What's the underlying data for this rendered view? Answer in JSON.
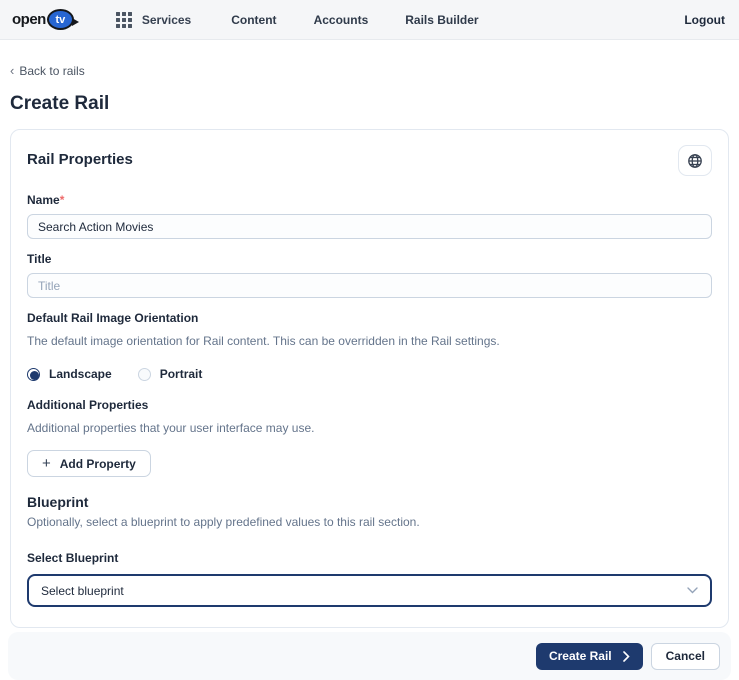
{
  "navbar": {
    "logo": {
      "text_open": "open",
      "text_tv": "tv"
    },
    "services_label": "Services",
    "items": [
      {
        "label": "Content"
      },
      {
        "label": "Accounts"
      },
      {
        "label": "Rails Builder"
      }
    ],
    "logout_label": "Logout"
  },
  "page": {
    "back_link_label": "Back to rails",
    "title": "Create Rail"
  },
  "form": {
    "section_title": "Rail Properties",
    "name_field": {
      "label": "Name",
      "required_mark": "*",
      "value": "Search Action Movies"
    },
    "title_field": {
      "label": "Title",
      "placeholder": "Title"
    },
    "orientation": {
      "label": "Default Rail Image Orientation",
      "description": "The default image orientation for Rail content. This can be overridden in the Rail settings.",
      "options": [
        {
          "label": "Landscape",
          "selected": true
        },
        {
          "label": "Portrait",
          "selected": false
        }
      ]
    },
    "additional_properties": {
      "label": "Additional Properties",
      "description": "Additional properties that your user interface may use.",
      "add_button_label": "Add Property"
    },
    "blueprint": {
      "title": "Blueprint",
      "description": "Optionally, select a blueprint to apply predefined values to this rail section.",
      "select_label": "Select Blueprint",
      "select_value": "Select blueprint"
    }
  },
  "footer": {
    "create_button_label": "Create Rail",
    "cancel_button_label": "Cancel"
  },
  "icons": {
    "back_chevron": "‹",
    "plus": "+",
    "create_chevron": "›"
  },
  "colors": {
    "accent_navy": "#1e3a6e",
    "logo_blue": "#2766d2",
    "required_red": "#ee6a6a",
    "muted_text": "#64748b",
    "navbar_bg": "#f5f6f8",
    "footer_bg": "#f7f9fb",
    "input_border": "#cbd5e1"
  }
}
